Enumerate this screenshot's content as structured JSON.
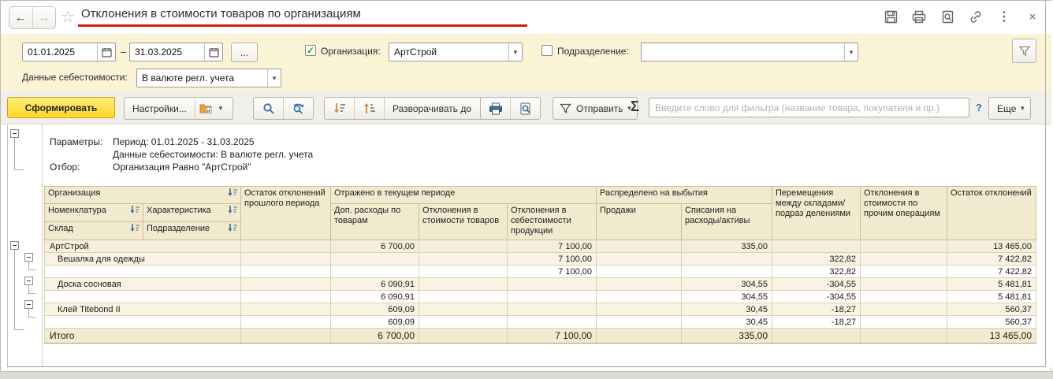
{
  "titlebar": {
    "title": "Отклонения в стоимости товаров по организациям",
    "back": "←",
    "forward": "→",
    "star": "☆",
    "more_dots": "⋮",
    "close": "×"
  },
  "filters": {
    "period_from": "01.01.2025",
    "dash": "–",
    "period_to": "31.03.2025",
    "more_button": "...",
    "organization": {
      "checked": true,
      "label": "Организация:",
      "value": "АртСтрой"
    },
    "division": {
      "checked": false,
      "label": "Подразделение:",
      "value": ""
    },
    "cost_data": {
      "label": "Данные себестоимости:",
      "value": "В валюте регл. учета"
    },
    "check_glyph": "✓"
  },
  "toolbar": {
    "generate": "Сформировать",
    "settings": "Настройки...",
    "expand_to": "Разворачивать до",
    "send": "Отправить",
    "sigma": "Σ",
    "filter_placeholder": "Введите слово для фильтра (название товара, покупателя и пр.)",
    "help": "?",
    "more": "Еще"
  },
  "report": {
    "params_label": "Параметры:",
    "params_line1": "Период: 01.01.2025 - 31.03.2025",
    "params_line2": "Данные себестоимости: В валюте регл. учета",
    "selection_label": "Отбор:",
    "selection_value": "Организация Равно \"АртСтрой\"",
    "table": {
      "h_organization": "Организация",
      "h_nomenclature": "Номенклатура",
      "h_characteristic": "Характеристика",
      "h_warehouse": "Склад",
      "h_division": "Подразделение",
      "h_balance_prev": "Остаток отклонений прошлого периода",
      "g_current_period": "Отражено в текущем периоде",
      "h_add_expenses": "Доп. расходы по товарам",
      "h_dev_goods_cost": "Отклонения в стоимости товаров",
      "h_dev_production_cost": "Отклонения в себестоимости продукции",
      "g_disposals": "Распределено на выбытия",
      "h_sales": "Продажи",
      "h_writeoffs": "Списания на расходы/активы",
      "h_transfers": "Перемещения между складами/подраз делениями",
      "h_dev_other": "Отклонения в стоимости по прочим операциям",
      "h_balance_end": "Остаток отклонений",
      "rows": [
        {
          "level": "org",
          "name": "АртСтрой",
          "values": [
            "",
            "6 700,00",
            "",
            "7 100,00",
            "",
            "335,00",
            "",
            "",
            "13 465,00"
          ]
        },
        {
          "level": "item",
          "name": "Вешалка для одежды",
          "values": [
            "",
            "",
            "",
            "7 100,00",
            "",
            "",
            "322,82",
            "",
            "7 422,82"
          ]
        },
        {
          "level": "detail",
          "name": "",
          "values": [
            "",
            "",
            "",
            "7 100,00",
            "",
            "",
            "322,82",
            "",
            "7 422,82"
          ]
        },
        {
          "level": "item",
          "name": "Доска сосновая",
          "values": [
            "",
            "6 090,91",
            "",
            "",
            "",
            "304,55",
            "-304,55",
            "",
            "5 481,81"
          ]
        },
        {
          "level": "detail",
          "name": "",
          "values": [
            "",
            "6 090,91",
            "",
            "",
            "",
            "304,55",
            "-304,55",
            "",
            "5 481,81"
          ]
        },
        {
          "level": "item",
          "name": "Клей Titebond II",
          "values": [
            "",
            "609,09",
            "",
            "",
            "",
            "30,45",
            "-18,27",
            "",
            "560,37"
          ]
        },
        {
          "level": "detail",
          "name": "",
          "values": [
            "",
            "609,09",
            "",
            "",
            "",
            "30,45",
            "-18,27",
            "",
            "560,37"
          ]
        },
        {
          "level": "total",
          "name": "Итого",
          "values": [
            "",
            "6 700,00",
            "",
            "7 100,00",
            "",
            "335,00",
            "",
            "",
            "13 465,00"
          ]
        }
      ]
    }
  }
}
